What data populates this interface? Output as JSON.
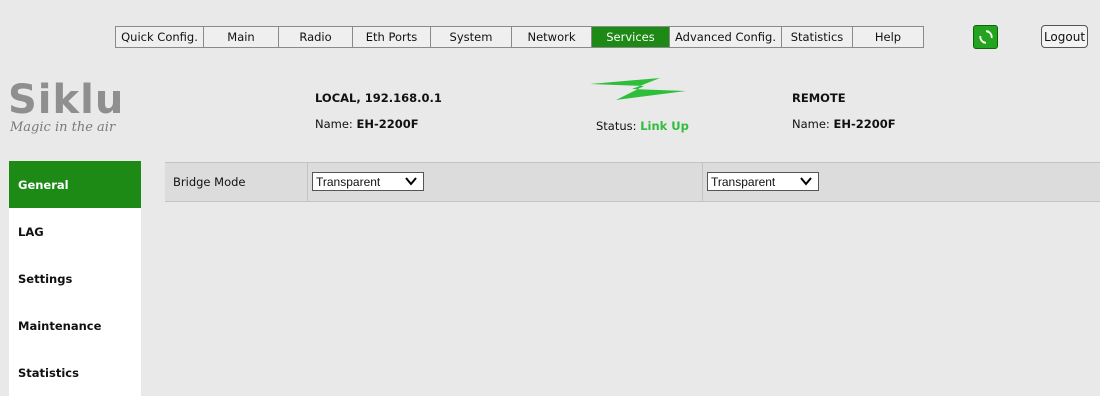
{
  "nav": {
    "tabs": [
      {
        "label": "Quick Config."
      },
      {
        "label": "Main"
      },
      {
        "label": "Radio"
      },
      {
        "label": "Eth Ports"
      },
      {
        "label": "System"
      },
      {
        "label": "Network"
      },
      {
        "label": "Services",
        "active": true
      },
      {
        "label": "Advanced Config."
      },
      {
        "label": "Statistics"
      },
      {
        "label": "Help"
      }
    ],
    "refresh_icon": "refresh-icon",
    "logout_label": "Logout"
  },
  "logo": {
    "word": "Siklu",
    "tagline": "Magic in the air"
  },
  "local": {
    "title": "LOCAL, 192.168.0.1",
    "name_label": "Name:",
    "name_value": "EH-2200F"
  },
  "link": {
    "icon": "lightning-bolt-icon",
    "status_label": "Status:",
    "status_value": "Link Up"
  },
  "remote": {
    "title": "REMOTE",
    "name_label": "Name:",
    "name_value": "EH-2200F"
  },
  "sidebar": {
    "items": [
      {
        "label": "General",
        "active": true
      },
      {
        "label": "LAG"
      },
      {
        "label": "Settings"
      },
      {
        "label": "Maintenance"
      },
      {
        "label": "Statistics"
      }
    ]
  },
  "bridge": {
    "label": "Bridge Mode",
    "local_value": "Transparent",
    "remote_value": "Transparent"
  },
  "colors": {
    "accent": "#1c8a14",
    "status_green": "#2fbe3c"
  }
}
